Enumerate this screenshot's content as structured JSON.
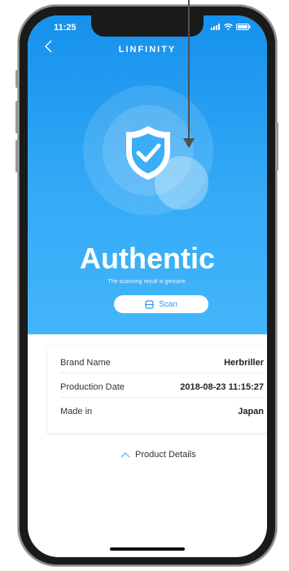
{
  "status": {
    "time": "11:25"
  },
  "header": {
    "title": "LINFINITY"
  },
  "result": {
    "title": "Authentic",
    "subtitle": "The scanning result is genuine."
  },
  "scan_button": {
    "label": "Scan"
  },
  "product": {
    "rows": [
      {
        "label": "Brand Name",
        "value": "Herbriller"
      },
      {
        "label": "Production Date",
        "value": "2018-08-23 11:15:27"
      },
      {
        "label": "Made in",
        "value": "Japan"
      }
    ],
    "details_label": "Product Details"
  },
  "colors": {
    "accent": "#1591ec",
    "scan_text": "#2e95ee",
    "hero_light": "#43b6fa"
  },
  "icons": [
    "back-chevron-icon",
    "signal-icon",
    "wifi-icon",
    "battery-icon",
    "shield-check-icon",
    "scan-icon",
    "chevron-up-icon"
  ]
}
